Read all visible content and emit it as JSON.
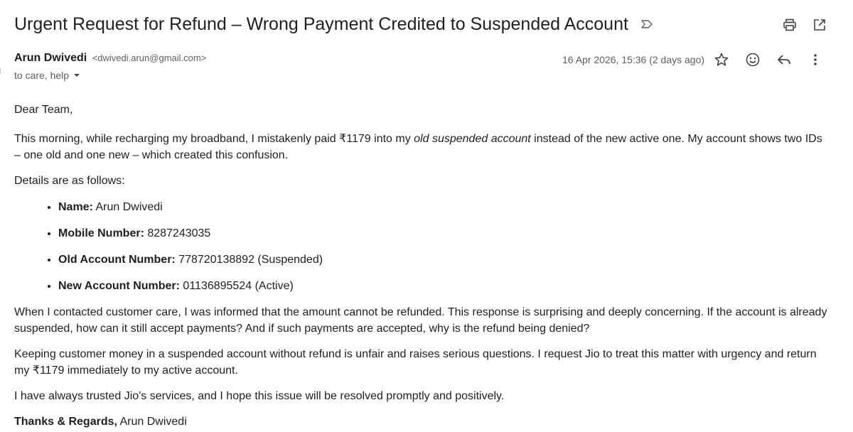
{
  "subject": "Urgent Request for Refund – Wrong Payment Credited to Suspended Account",
  "sender": {
    "name": "Arun Dwivedi",
    "email": "<dwivedi.arun@gmail.com>"
  },
  "recipients": "to care, help",
  "date": "16 Apr 2026, 15:36 (2 days ago)",
  "icons": {
    "label": "important-label-icon",
    "print": "print-icon",
    "open_new_window": "open-in-new-window-icon",
    "star": "star-icon",
    "emoji": "emoji-icon",
    "reply": "reply-icon",
    "more": "more-vertical-icon",
    "dropdown": "caret-down-icon"
  },
  "body": {
    "greeting": "Dear Team,",
    "p1": {
      "before": "This morning, while recharging my broadband, I mistakenly paid ₹1179 into my ",
      "emphasis": "old suspended account",
      "after": " instead of the new active one. My account shows two IDs – one old and one new – which created this confusion."
    },
    "details_intro": "Details are as follows:",
    "details": [
      {
        "label": "Name:",
        "value": " Arun Dwivedi"
      },
      {
        "label": "Mobile Number:",
        "value": " 8287243035"
      },
      {
        "label": "Old Account Number:",
        "value": " 778720138892 (Suspended)"
      },
      {
        "label": "New Account Number:",
        "value": " 01136895524 (Active)"
      }
    ],
    "p2": "When I contacted customer care, I was informed that the amount cannot be refunded. This response is surprising and deeply concerning. If the account is already suspended, how can it still accept payments? And if such payments are accepted, why is the refund being denied?",
    "p3": "Keeping customer money in a suspended account without refund is unfair and raises serious questions. I request Jio to treat this matter with urgency and return my ₹1179 immediately to my active account.",
    "p4": "I have always trusted Jio's services, and I hope this issue will be resolved promptly and positively.",
    "signoff": "Thanks & Regards,",
    "signature": " Arun Dwivedi"
  }
}
